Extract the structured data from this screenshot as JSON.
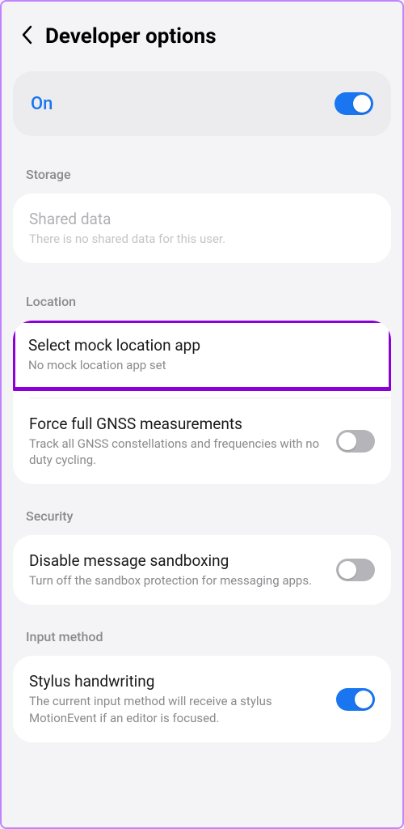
{
  "header": {
    "title": "Developer options"
  },
  "master": {
    "label": "On",
    "enabled": true
  },
  "sections": {
    "storage": {
      "header": "Storage",
      "shared_data": {
        "title": "Shared data",
        "sub": "There is no shared data for this user."
      }
    },
    "location": {
      "header": "Location",
      "mock": {
        "title": "Select mock location app",
        "sub": "No mock location app set"
      },
      "gnss": {
        "title": "Force full GNSS measurements",
        "sub": "Track all GNSS constellations and frequencies with no duty cycling.",
        "enabled": false
      }
    },
    "security": {
      "header": "Security",
      "sandbox": {
        "title": "Disable message sandboxing",
        "sub": "Turn off the sandbox protection for messaging apps.",
        "enabled": false
      }
    },
    "input": {
      "header": "Input method",
      "stylus": {
        "title": "Stylus handwriting",
        "sub": "The current input method will receive a stylus MotionEvent if an editor is focused.",
        "enabled": true
      }
    }
  },
  "colors": {
    "accent": "#1976f0",
    "highlight": "#8b00d6"
  }
}
